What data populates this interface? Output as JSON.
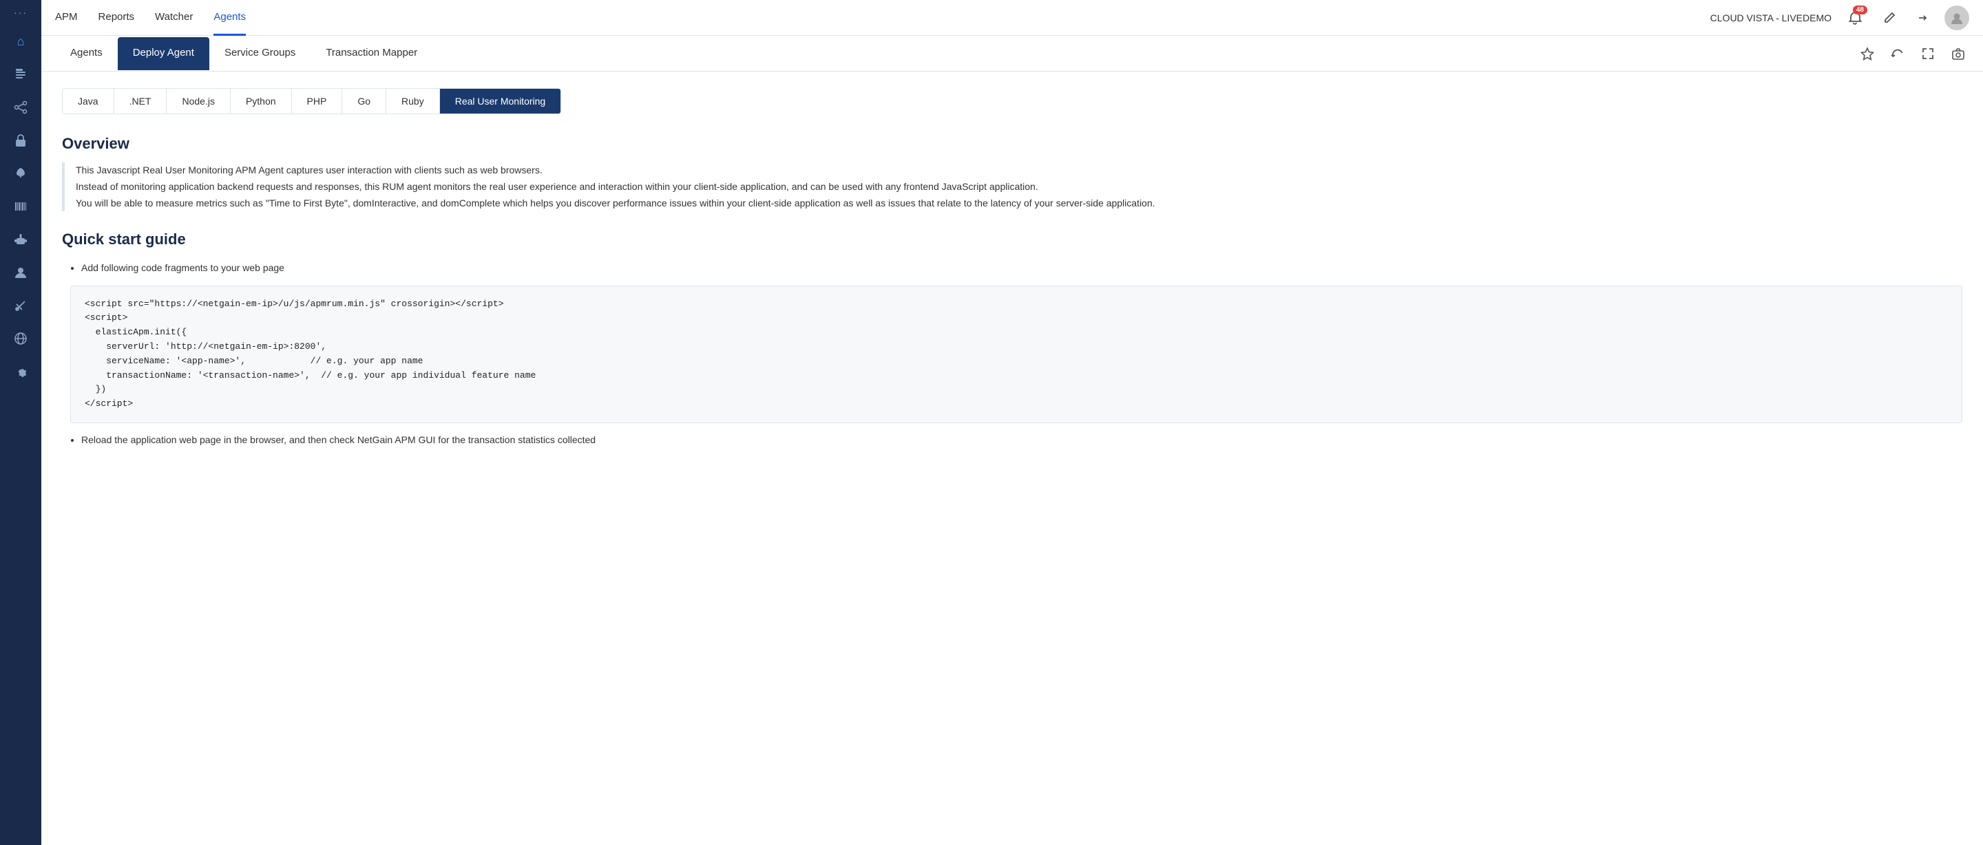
{
  "app": {
    "title": "CLOUD VISTA - LIVEDEMO"
  },
  "topNav": {
    "links": [
      {
        "id": "apm",
        "label": "APM",
        "active": false
      },
      {
        "id": "reports",
        "label": "Reports",
        "active": false
      },
      {
        "id": "watcher",
        "label": "Watcher",
        "active": false
      },
      {
        "id": "agents",
        "label": "Agents",
        "active": true
      }
    ],
    "notification_count": "48"
  },
  "subNav": {
    "links": [
      {
        "id": "agents",
        "label": "Agents",
        "active": false
      },
      {
        "id": "deploy-agent",
        "label": "Deploy Agent",
        "active": true
      },
      {
        "id": "service-groups",
        "label": "Service Groups",
        "active": false
      },
      {
        "id": "transaction-mapper",
        "label": "Transaction Mapper",
        "active": false
      }
    ]
  },
  "langTabs": {
    "tabs": [
      {
        "id": "java",
        "label": "Java",
        "active": false
      },
      {
        "id": "dotnet",
        "label": ".NET",
        "active": false
      },
      {
        "id": "nodejs",
        "label": "Node.js",
        "active": false
      },
      {
        "id": "python",
        "label": "Python",
        "active": false
      },
      {
        "id": "php",
        "label": "PHP",
        "active": false
      },
      {
        "id": "go",
        "label": "Go",
        "active": false
      },
      {
        "id": "ruby",
        "label": "Ruby",
        "active": false
      },
      {
        "id": "rum",
        "label": "Real User Monitoring",
        "active": true
      }
    ]
  },
  "overview": {
    "title": "Overview",
    "paragraph1": "This Javascript Real User Monitoring APM Agent captures user interaction with clients such as web browsers.",
    "paragraph2": "Instead of monitoring application backend requests and responses, this RUM agent monitors the real user experience and interaction within your client-side application, and can be used with any frontend JavaScript application.",
    "paragraph3": "You will be able to measure metrics such as \"Time to First Byte\", domInteractive, and domComplete which helps you discover performance issues within your client-side application as well as issues that relate to the latency of your server-side application."
  },
  "quickStart": {
    "title": "Quick start guide",
    "bullet1": "Add following code fragments to your web page",
    "code": "<script src=\"https://<netgain-em-ip>/u/js/apmrum.min.js\" crossorigin></script>\n<script>\n  elasticApm.init({\n    serverUrl: 'http://<netgain-em-ip>:8200',\n    serviceName: '<app-name>',            // e.g. your app name\n    transactionName: '<transaction-name>',  // e.g. your app individual feature name\n  })\n</script>",
    "bullet2": "Reload the application web page in the browser, and then check NetGain APM GUI for the transaction statistics collected"
  },
  "sidebar": {
    "icons": [
      {
        "id": "home",
        "symbol": "⌂"
      },
      {
        "id": "document",
        "symbol": "📄"
      },
      {
        "id": "nodes",
        "symbol": "⬡"
      },
      {
        "id": "lock",
        "symbol": "🔒"
      },
      {
        "id": "rocket",
        "symbol": "🚀"
      },
      {
        "id": "barcode",
        "symbol": "▦"
      },
      {
        "id": "robot",
        "symbol": "🤖"
      },
      {
        "id": "user",
        "symbol": "👤"
      },
      {
        "id": "tools",
        "symbol": "⚙"
      },
      {
        "id": "globe",
        "symbol": "🌐"
      },
      {
        "id": "gear",
        "symbol": "⚙"
      }
    ]
  }
}
